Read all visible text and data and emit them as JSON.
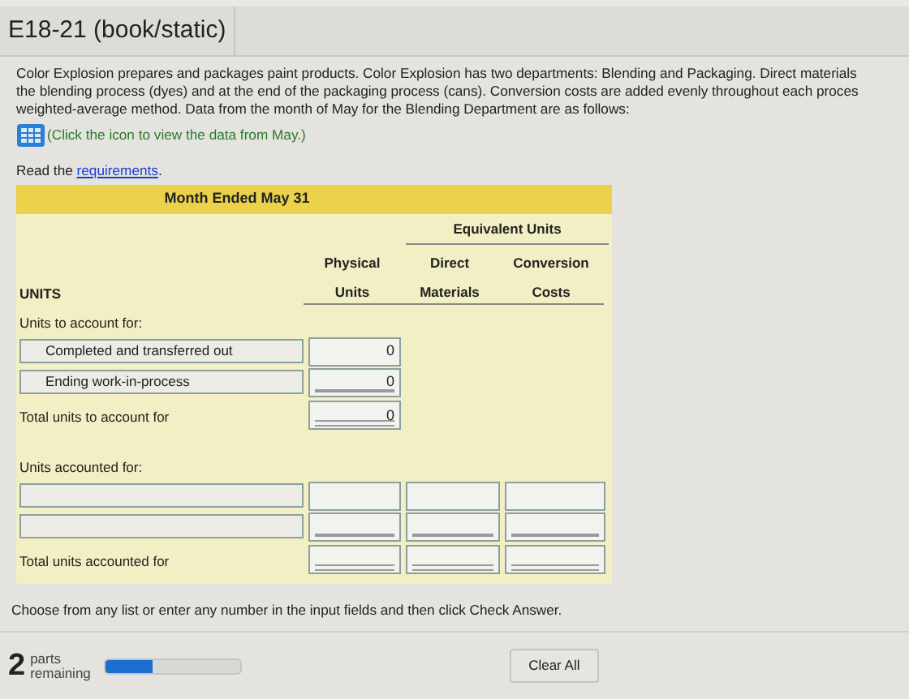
{
  "title": "E18-21 (book/static)",
  "paragraph_lines": [
    "Color Explosion prepares and packages paint products. Color Explosion has two departments: Blending and Packaging. Direct materials",
    "the blending process (dyes) and at the end of the packaging process (cans). Conversion costs are added evenly throughout each proces",
    "weighted-average method. Data from the month of May for the Blending Department are as follows:"
  ],
  "data_hint": "(Click the icon to view the data from May.)",
  "read_prefix": "Read the ",
  "read_link": "requirements",
  "read_suffix": ".",
  "table": {
    "caption": "Month Ended May 31",
    "group_heading": "Equivalent Units",
    "headings": [
      {
        "bottom": "UNITS"
      },
      {
        "top": "Physical",
        "bottom": "Units"
      },
      {
        "top": "Direct",
        "bottom": "Materials"
      },
      {
        "top": "Conversion",
        "bottom": "Costs"
      }
    ],
    "rows": [
      {
        "kind": "section",
        "label": "Units to account for:"
      },
      {
        "kind": "input",
        "label": "Completed and transferred out",
        "values": [
          {
            "kind": "number",
            "value": "0"
          }
        ],
        "underlined": false,
        "double_underlined": false
      },
      {
        "kind": "input",
        "label": "Ending work-in-process",
        "values": [
          {
            "kind": "number",
            "value": "0"
          }
        ],
        "underlined": true,
        "double_underlined": false
      },
      {
        "kind": "total",
        "label": "Total units to account for",
        "values": [
          {
            "kind": "number",
            "value": "0"
          }
        ],
        "underlined": false,
        "double_underlined": true
      },
      {
        "kind": "spacer"
      },
      {
        "kind": "section",
        "label": "Units accounted for:"
      },
      {
        "kind": "input",
        "values": [
          {
            "kind": "blank"
          },
          {
            "kind": "blank"
          },
          {
            "kind": "blank"
          }
        ],
        "underlined": false,
        "double_underlined": false
      },
      {
        "kind": "input",
        "values": [
          {
            "kind": "blank"
          },
          {
            "kind": "blank"
          },
          {
            "kind": "blank"
          }
        ],
        "underlined": true,
        "double_underlined": false
      },
      {
        "kind": "total",
        "label": "Total units accounted for",
        "values": [
          {
            "kind": "blank"
          },
          {
            "kind": "blank"
          },
          {
            "kind": "blank"
          }
        ],
        "underlined": false,
        "double_underlined": true
      }
    ]
  },
  "instruction": "Choose from any list or enter any number in the input fields and then click Check Answer.",
  "parts_count": "2",
  "parts_label_1": "parts",
  "parts_label_2": "remaining",
  "progress": {
    "level": 0.35
  },
  "clear_button": "Clear All"
}
